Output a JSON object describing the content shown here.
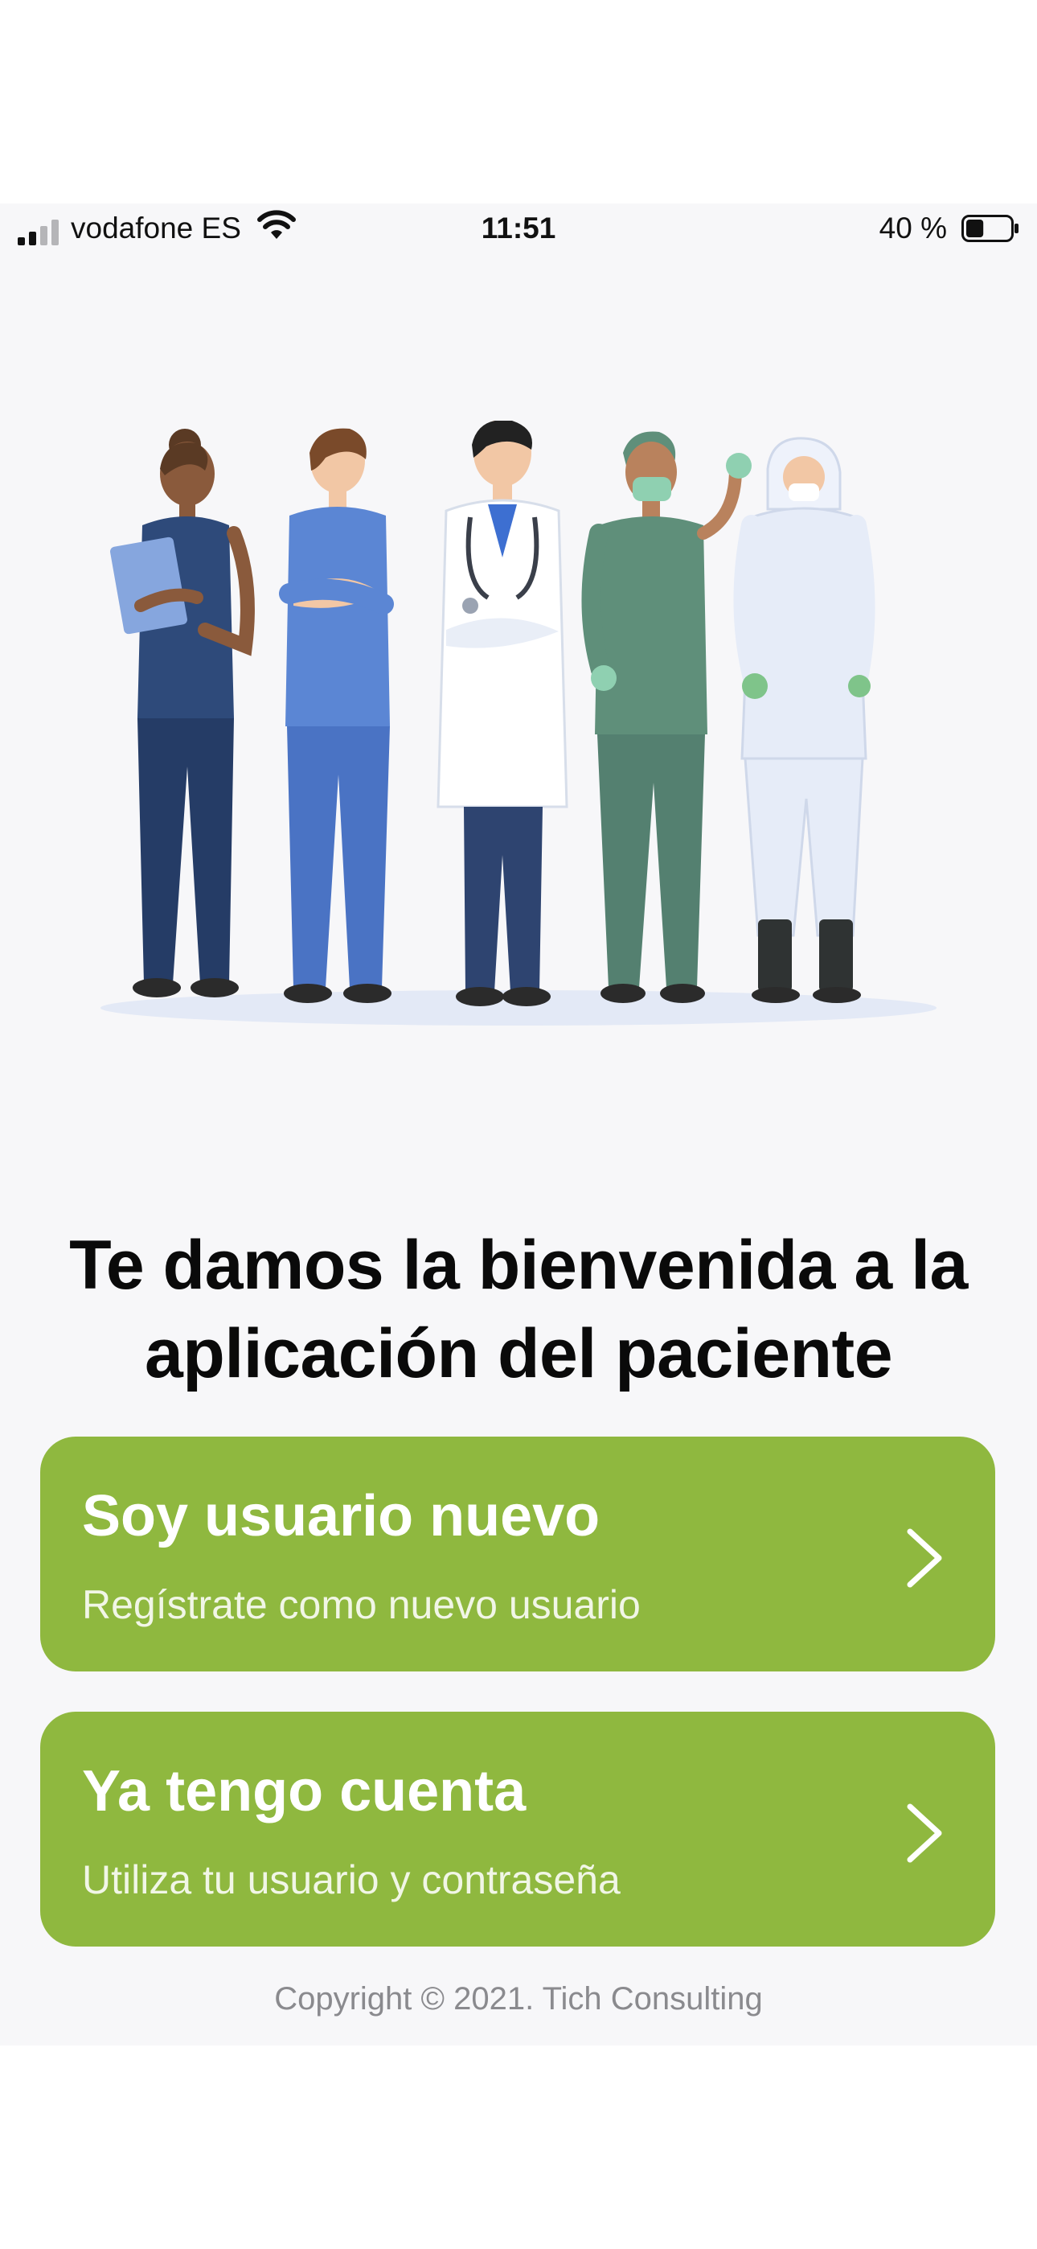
{
  "status_bar": {
    "carrier": "vodafone ES",
    "time": "11:51",
    "battery_percent": "40 %",
    "battery_level": 0.4,
    "icons": [
      "signal-icon",
      "wifi-icon",
      "battery-icon"
    ]
  },
  "illustration": {
    "name": "healthcare-staff-illustration"
  },
  "welcome": {
    "title_line1": "Te damos la bienvenida a la",
    "title_line2": "aplicación del paciente"
  },
  "actions": [
    {
      "title": "Soy usuario nuevo",
      "subtitle": "Regístrate como nuevo usuario",
      "icon": "chevron-right-icon"
    },
    {
      "title": "Ya tengo cuenta",
      "subtitle": "Utiliza tu usuario y contraseña",
      "icon": "chevron-right-icon"
    }
  ],
  "footer": {
    "copyright": "Copyright © 2021. Tich Consulting"
  },
  "colors": {
    "accent": "#8fb83f",
    "background": "#f7f7f9",
    "title": "#0a0a0a",
    "muted": "#8a8a8e"
  }
}
